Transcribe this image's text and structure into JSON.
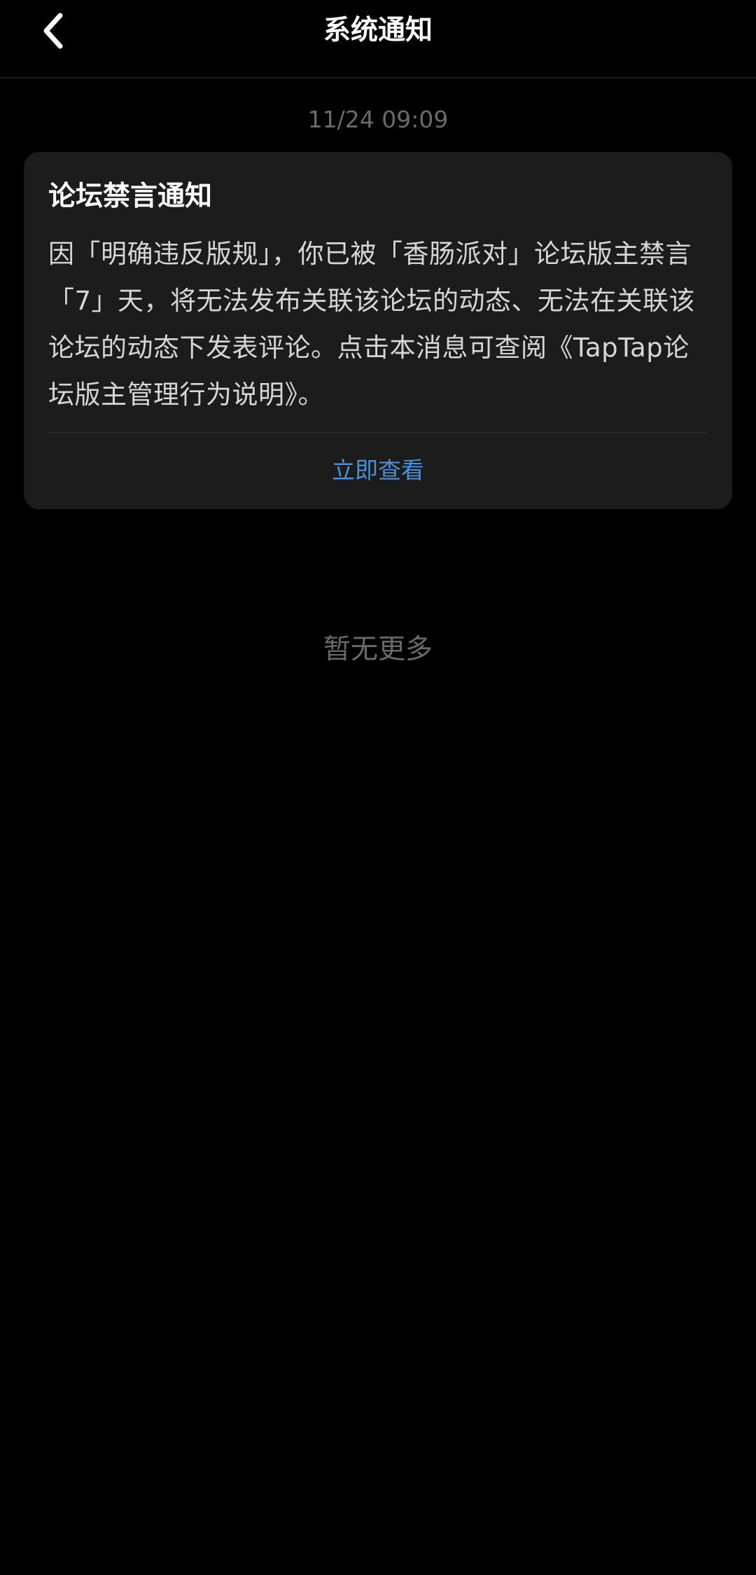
{
  "header": {
    "title": "系统通知",
    "back_icon": "chevron-left-icon"
  },
  "messages": [
    {
      "time": "11/24  09:09",
      "title": "论坛禁言通知",
      "body": "因「明确违反版规」，你已被「香肠派对」论坛版主禁言「7」天，将无法发布关联该论坛的动态、无法在关联该论坛的动态下发表评论。点击本消息可查阅《TapTap论坛版主管理行为说明》。",
      "action_label": "立即查看"
    }
  ],
  "footer": {
    "no_more": "暂无更多"
  },
  "colors": {
    "background": "#000000",
    "card": "#1c1c1c",
    "link": "#4a90d9",
    "muted": "#6a6a6a"
  }
}
